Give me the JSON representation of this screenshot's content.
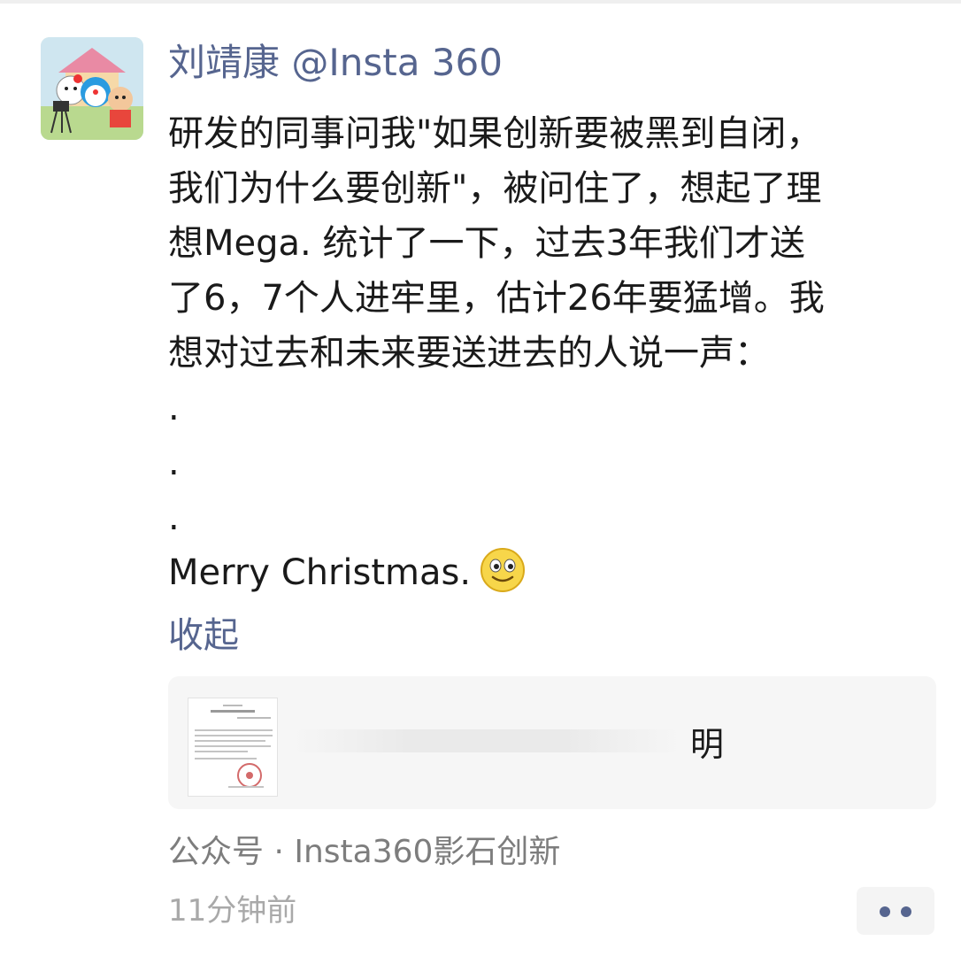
{
  "post": {
    "author": "刘靖康 @Insta 360",
    "lines": [
      "研发的同事问我\"如果创新要被黑到自闭，",
      "我们为什么要创新\"，被问住了，想起了理",
      "想Mega. 统计了一下，过去3年我们才送",
      "了6，7个人进牢里，估计26年要猛增。我",
      "想对过去和未来要送进去的人说一声：",
      ".",
      ".",
      "."
    ],
    "closing": "Merry Christmas.",
    "emoji": "smile-emoji",
    "collapse_label": "收起"
  },
  "link_card": {
    "title": "明",
    "thumbnail": "document-icon"
  },
  "source": "公众号 · Insta360影石创新",
  "timestamp": "11分钟前",
  "more_button": {
    "icon": "more-dots-icon"
  },
  "colors": {
    "link_blue": "#56658f",
    "text": "#1a1a1a",
    "secondary": "#7d7d7d",
    "timestamp": "#a9a9a9",
    "card_bg": "#f6f6f6"
  }
}
